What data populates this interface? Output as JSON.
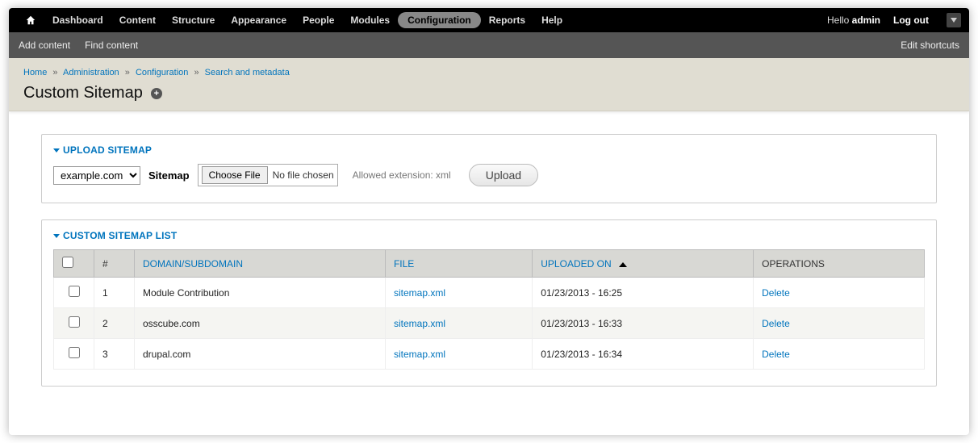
{
  "toolbar": {
    "items": [
      {
        "key": "home",
        "icon": true
      },
      {
        "key": "dashboard",
        "label": "Dashboard"
      },
      {
        "key": "content",
        "label": "Content"
      },
      {
        "key": "structure",
        "label": "Structure"
      },
      {
        "key": "appearance",
        "label": "Appearance"
      },
      {
        "key": "people",
        "label": "People"
      },
      {
        "key": "modules",
        "label": "Modules"
      },
      {
        "key": "configuration",
        "label": "Configuration",
        "active": true
      },
      {
        "key": "reports",
        "label": "Reports"
      },
      {
        "key": "help",
        "label": "Help"
      }
    ],
    "hello_prefix": "Hello ",
    "username": "admin",
    "logout": "Log out"
  },
  "shortcuts": {
    "items": [
      {
        "label": "Add content"
      },
      {
        "label": "Find content"
      }
    ],
    "edit": "Edit shortcuts"
  },
  "breadcrumb": [
    {
      "label": "Home",
      "link": true
    },
    {
      "label": "Administration",
      "link": true
    },
    {
      "label": "Configuration",
      "link": true
    },
    {
      "label": "Search and metadata",
      "link": true
    }
  ],
  "page_title": "Custom Sitemap",
  "upload": {
    "legend": "UPLOAD SITEMAP",
    "domain_selected": "example.com",
    "sitemap_label": "Sitemap",
    "choose_file_label": "Choose File",
    "file_status": "No file chosen",
    "allowed_ext": "Allowed extension: xml",
    "upload_button": "Upload"
  },
  "list": {
    "legend": "CUSTOM SITEMAP LIST",
    "headers": {
      "num": "#",
      "domain": "DOMAIN/SUBDOMAIN",
      "file": "FILE",
      "uploaded": "UPLOADED ON",
      "operations": "OPERATIONS"
    },
    "sorted_by": "uploaded",
    "sort_dir": "asc",
    "rows": [
      {
        "num": "1",
        "domain": "Module Contribution",
        "file": "sitemap.xml",
        "uploaded": "01/23/2013 - 16:25",
        "op": "Delete"
      },
      {
        "num": "2",
        "domain": "osscube.com",
        "file": "sitemap.xml",
        "uploaded": "01/23/2013 - 16:33",
        "op": "Delete"
      },
      {
        "num": "3",
        "domain": "drupal.com",
        "file": "sitemap.xml",
        "uploaded": "01/23/2013 - 16:34",
        "op": "Delete"
      }
    ]
  }
}
